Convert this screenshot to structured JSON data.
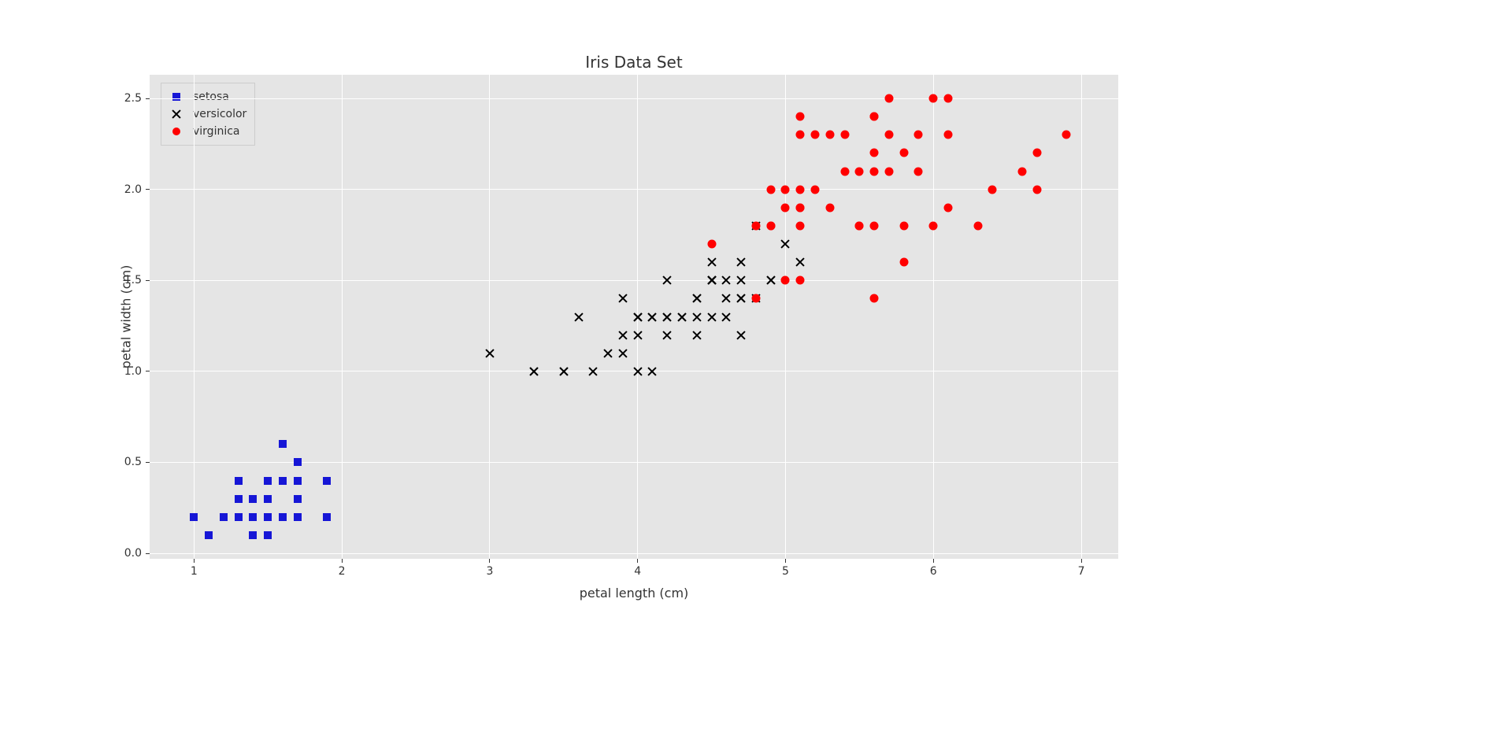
{
  "chart_data": {
    "type": "scatter",
    "title": "Iris Data Set",
    "xlabel": "petal length (cm)",
    "ylabel": "petal width (cm)",
    "xlim": [
      0.7,
      7.25
    ],
    "ylim": [
      -0.03,
      2.63
    ],
    "xticks": [
      1,
      2,
      3,
      4,
      5,
      6,
      7
    ],
    "yticks": [
      0.0,
      0.5,
      1.0,
      1.5,
      2.0,
      2.5
    ],
    "xtick_labels": [
      "1",
      "2",
      "3",
      "4",
      "5",
      "6",
      "7"
    ],
    "ytick_labels": [
      "0.0",
      "0.5",
      "1.0",
      "1.5",
      "2.0",
      "2.5"
    ],
    "legend_position": "upper left",
    "series": [
      {
        "name": "setosa",
        "marker": "square",
        "color": "#1616d6",
        "points": [
          [
            1.4,
            0.2
          ],
          [
            1.4,
            0.2
          ],
          [
            1.3,
            0.2
          ],
          [
            1.5,
            0.2
          ],
          [
            1.4,
            0.2
          ],
          [
            1.7,
            0.4
          ],
          [
            1.4,
            0.3
          ],
          [
            1.5,
            0.2
          ],
          [
            1.4,
            0.2
          ],
          [
            1.5,
            0.1
          ],
          [
            1.5,
            0.2
          ],
          [
            1.6,
            0.2
          ],
          [
            1.4,
            0.1
          ],
          [
            1.1,
            0.1
          ],
          [
            1.2,
            0.2
          ],
          [
            1.5,
            0.4
          ],
          [
            1.3,
            0.4
          ],
          [
            1.4,
            0.3
          ],
          [
            1.7,
            0.3
          ],
          [
            1.5,
            0.3
          ],
          [
            1.7,
            0.2
          ],
          [
            1.5,
            0.4
          ],
          [
            1.0,
            0.2
          ],
          [
            1.7,
            0.5
          ],
          [
            1.9,
            0.2
          ],
          [
            1.6,
            0.2
          ],
          [
            1.6,
            0.4
          ],
          [
            1.5,
            0.2
          ],
          [
            1.4,
            0.2
          ],
          [
            1.6,
            0.2
          ],
          [
            1.6,
            0.2
          ],
          [
            1.5,
            0.4
          ],
          [
            1.5,
            0.1
          ],
          [
            1.4,
            0.2
          ],
          [
            1.5,
            0.2
          ],
          [
            1.2,
            0.2
          ],
          [
            1.3,
            0.2
          ],
          [
            1.4,
            0.1
          ],
          [
            1.3,
            0.2
          ],
          [
            1.5,
            0.2
          ],
          [
            1.3,
            0.3
          ],
          [
            1.3,
            0.3
          ],
          [
            1.3,
            0.2
          ],
          [
            1.6,
            0.6
          ],
          [
            1.9,
            0.4
          ],
          [
            1.4,
            0.3
          ],
          [
            1.6,
            0.2
          ],
          [
            1.4,
            0.2
          ],
          [
            1.5,
            0.2
          ],
          [
            1.4,
            0.2
          ]
        ]
      },
      {
        "name": "versicolor",
        "marker": "x",
        "color": "#000000",
        "points": [
          [
            4.7,
            1.4
          ],
          [
            4.5,
            1.5
          ],
          [
            4.9,
            1.5
          ],
          [
            4.0,
            1.3
          ],
          [
            4.6,
            1.5
          ],
          [
            4.5,
            1.3
          ],
          [
            4.7,
            1.6
          ],
          [
            3.3,
            1.0
          ],
          [
            4.6,
            1.3
          ],
          [
            3.9,
            1.4
          ],
          [
            3.5,
            1.0
          ],
          [
            4.2,
            1.5
          ],
          [
            4.0,
            1.0
          ],
          [
            4.7,
            1.4
          ],
          [
            3.6,
            1.3
          ],
          [
            4.4,
            1.4
          ],
          [
            4.5,
            1.5
          ],
          [
            4.1,
            1.0
          ],
          [
            4.5,
            1.5
          ],
          [
            3.9,
            1.1
          ],
          [
            4.8,
            1.8
          ],
          [
            4.0,
            1.3
          ],
          [
            4.9,
            1.5
          ],
          [
            4.7,
            1.2
          ],
          [
            4.3,
            1.3
          ],
          [
            4.4,
            1.4
          ],
          [
            4.8,
            1.4
          ],
          [
            5.0,
            1.7
          ],
          [
            4.5,
            1.5
          ],
          [
            3.5,
            1.0
          ],
          [
            3.8,
            1.1
          ],
          [
            3.7,
            1.0
          ],
          [
            3.9,
            1.2
          ],
          [
            5.1,
            1.6
          ],
          [
            4.5,
            1.5
          ],
          [
            4.5,
            1.6
          ],
          [
            4.7,
            1.5
          ],
          [
            4.4,
            1.3
          ],
          [
            4.1,
            1.3
          ],
          [
            4.0,
            1.3
          ],
          [
            4.4,
            1.2
          ],
          [
            4.6,
            1.4
          ],
          [
            4.0,
            1.2
          ],
          [
            3.3,
            1.0
          ],
          [
            4.2,
            1.3
          ],
          [
            4.2,
            1.2
          ],
          [
            4.2,
            1.3
          ],
          [
            4.3,
            1.3
          ],
          [
            3.0,
            1.1
          ],
          [
            4.1,
            1.3
          ]
        ]
      },
      {
        "name": "virginica",
        "marker": "circle",
        "color": "#ff0000",
        "points": [
          [
            6.0,
            2.5
          ],
          [
            5.1,
            1.9
          ],
          [
            5.9,
            2.1
          ],
          [
            5.6,
            1.8
          ],
          [
            5.8,
            2.2
          ],
          [
            6.6,
            2.1
          ],
          [
            4.5,
            1.7
          ],
          [
            6.3,
            1.8
          ],
          [
            5.8,
            1.8
          ],
          [
            6.1,
            2.5
          ],
          [
            5.1,
            2.0
          ],
          [
            5.3,
            1.9
          ],
          [
            5.5,
            2.1
          ],
          [
            5.0,
            2.0
          ],
          [
            5.1,
            2.4
          ],
          [
            5.3,
            2.3
          ],
          [
            5.5,
            1.8
          ],
          [
            6.7,
            2.2
          ],
          [
            6.9,
            2.3
          ],
          [
            5.0,
            1.5
          ],
          [
            5.7,
            2.3
          ],
          [
            4.9,
            2.0
          ],
          [
            6.7,
            2.0
          ],
          [
            4.9,
            1.8
          ],
          [
            5.7,
            2.1
          ],
          [
            6.0,
            1.8
          ],
          [
            4.8,
            1.8
          ],
          [
            4.9,
            1.8
          ],
          [
            5.6,
            2.1
          ],
          [
            5.8,
            1.6
          ],
          [
            6.1,
            1.9
          ],
          [
            6.4,
            2.0
          ],
          [
            5.6,
            2.2
          ],
          [
            5.1,
            1.5
          ],
          [
            5.6,
            1.4
          ],
          [
            6.1,
            2.3
          ],
          [
            5.6,
            2.4
          ],
          [
            5.5,
            1.8
          ],
          [
            4.8,
            1.4
          ],
          [
            5.4,
            2.1
          ],
          [
            5.6,
            2.4
          ],
          [
            5.1,
            2.3
          ],
          [
            5.1,
            1.9
          ],
          [
            5.9,
            2.3
          ],
          [
            5.7,
            2.5
          ],
          [
            5.2,
            2.3
          ],
          [
            5.0,
            1.9
          ],
          [
            5.2,
            2.0
          ],
          [
            5.4,
            2.3
          ],
          [
            5.1,
            1.8
          ]
        ]
      }
    ]
  },
  "legend": {
    "items": [
      "setosa",
      "versicolor",
      "virginica"
    ]
  }
}
